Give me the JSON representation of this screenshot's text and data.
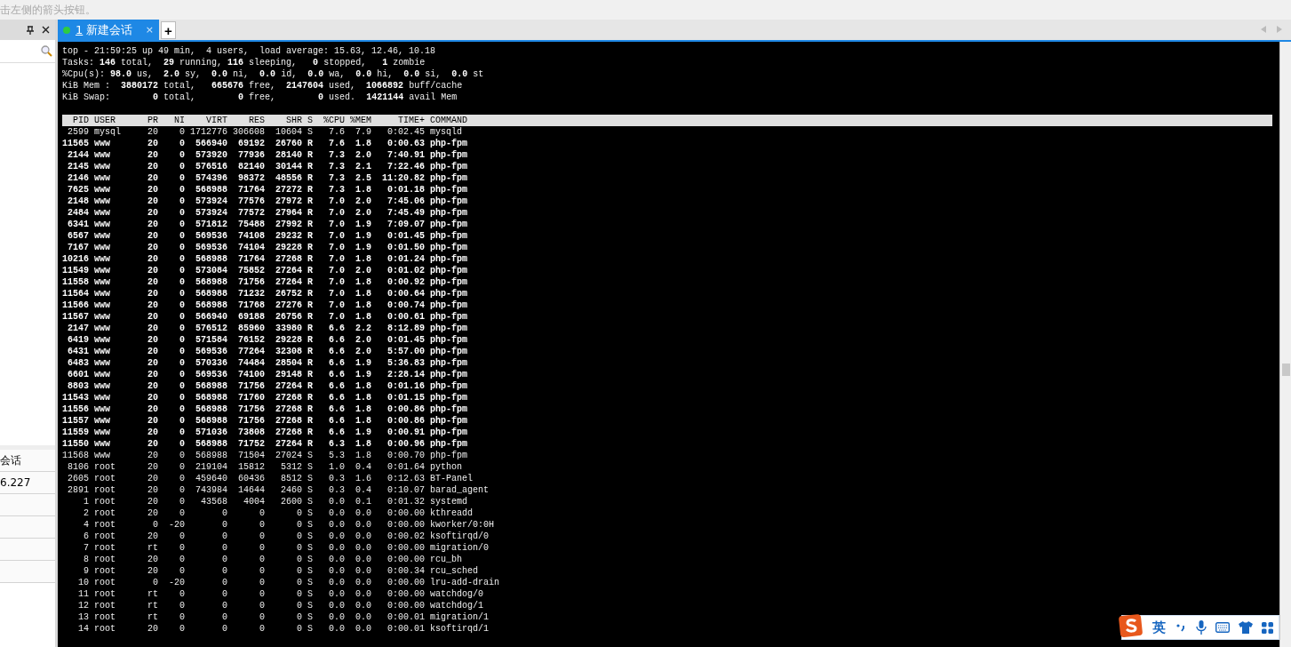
{
  "hint_bar": {
    "text": "击左侧的箭头按钮。"
  },
  "side_panel": {
    "rows": [
      "会话",
      "6.227"
    ]
  },
  "tabs": [
    {
      "number": "1",
      "label": "新建会话",
      "selected": true,
      "connected": true,
      "close": "×"
    }
  ],
  "new_tab": "+",
  "terminal": {
    "summary": [
      "top - 21:59:25 up 49 min,  4 users,  load average: 15.63, 12.46, 10.18",
      "Tasks: **146** total,  **29** running, **116** sleeping,   **0** stopped,   **1** zombie",
      "%Cpu(s): **98.0** us,  **2.0** sy,  **0.0** ni,  **0.0** id,  **0.0** wa,  **0.0** hi,  **0.0** si,  **0.0** st",
      "KiB Mem :  **3880172** total,   **665676** free,  **2147604** used,  **1066892** buff/cache",
      "KiB Swap:        **0** total,        **0** free,        **0** used.  **1421144** avail Mem"
    ],
    "columns": [
      "PID",
      "USER",
      "PR",
      "NI",
      "VIRT",
      "RES",
      "SHR",
      "S",
      "%CPU",
      "%MEM",
      "TIME+",
      "COMMAND"
    ],
    "rows": [
      {
        "bold": false,
        "cells": [
          "2599",
          "mysql",
          "20",
          "0",
          "1712776",
          "306608",
          "10604",
          "S",
          "7.6",
          "7.9",
          "0:02.45",
          "mysqld"
        ]
      },
      {
        "bold": true,
        "cells": [
          "11565",
          "www",
          "20",
          "0",
          "566940",
          "69192",
          "26760",
          "R",
          "7.6",
          "1.8",
          "0:00.63",
          "php-fpm"
        ]
      },
      {
        "bold": true,
        "cells": [
          "2144",
          "www",
          "20",
          "0",
          "573920",
          "77936",
          "28140",
          "R",
          "7.3",
          "2.0",
          "7:40.91",
          "php-fpm"
        ]
      },
      {
        "bold": true,
        "cells": [
          "2145",
          "www",
          "20",
          "0",
          "576516",
          "82140",
          "30144",
          "R",
          "7.3",
          "2.1",
          "7:22.46",
          "php-fpm"
        ]
      },
      {
        "bold": true,
        "cells": [
          "2146",
          "www",
          "20",
          "0",
          "574396",
          "98372",
          "48556",
          "R",
          "7.3",
          "2.5",
          "11:20.82",
          "php-fpm"
        ]
      },
      {
        "bold": true,
        "cells": [
          "7625",
          "www",
          "20",
          "0",
          "568988",
          "71764",
          "27272",
          "R",
          "7.3",
          "1.8",
          "0:01.18",
          "php-fpm"
        ]
      },
      {
        "bold": true,
        "cells": [
          "2148",
          "www",
          "20",
          "0",
          "573924",
          "77576",
          "27972",
          "R",
          "7.0",
          "2.0",
          "7:45.06",
          "php-fpm"
        ]
      },
      {
        "bold": true,
        "cells": [
          "2484",
          "www",
          "20",
          "0",
          "573924",
          "77572",
          "27964",
          "R",
          "7.0",
          "2.0",
          "7:45.49",
          "php-fpm"
        ]
      },
      {
        "bold": true,
        "cells": [
          "6341",
          "www",
          "20",
          "0",
          "571812",
          "75488",
          "27992",
          "R",
          "7.0",
          "1.9",
          "7:09.07",
          "php-fpm"
        ]
      },
      {
        "bold": true,
        "cells": [
          "6567",
          "www",
          "20",
          "0",
          "569536",
          "74108",
          "29232",
          "R",
          "7.0",
          "1.9",
          "0:01.45",
          "php-fpm"
        ]
      },
      {
        "bold": true,
        "cells": [
          "7167",
          "www",
          "20",
          "0",
          "569536",
          "74104",
          "29228",
          "R",
          "7.0",
          "1.9",
          "0:01.50",
          "php-fpm"
        ]
      },
      {
        "bold": true,
        "cells": [
          "10216",
          "www",
          "20",
          "0",
          "568988",
          "71764",
          "27268",
          "R",
          "7.0",
          "1.8",
          "0:01.24",
          "php-fpm"
        ]
      },
      {
        "bold": true,
        "cells": [
          "11549",
          "www",
          "20",
          "0",
          "573084",
          "75852",
          "27264",
          "R",
          "7.0",
          "2.0",
          "0:01.02",
          "php-fpm"
        ]
      },
      {
        "bold": true,
        "cells": [
          "11558",
          "www",
          "20",
          "0",
          "568988",
          "71756",
          "27264",
          "R",
          "7.0",
          "1.8",
          "0:00.92",
          "php-fpm"
        ]
      },
      {
        "bold": true,
        "cells": [
          "11564",
          "www",
          "20",
          "0",
          "568988",
          "71232",
          "26752",
          "R",
          "7.0",
          "1.8",
          "0:00.64",
          "php-fpm"
        ]
      },
      {
        "bold": true,
        "cells": [
          "11566",
          "www",
          "20",
          "0",
          "568988",
          "71768",
          "27276",
          "R",
          "7.0",
          "1.8",
          "0:00.74",
          "php-fpm"
        ]
      },
      {
        "bold": true,
        "cells": [
          "11567",
          "www",
          "20",
          "0",
          "566940",
          "69188",
          "26756",
          "R",
          "7.0",
          "1.8",
          "0:00.61",
          "php-fpm"
        ]
      },
      {
        "bold": true,
        "cells": [
          "2147",
          "www",
          "20",
          "0",
          "576512",
          "85960",
          "33980",
          "R",
          "6.6",
          "2.2",
          "8:12.89",
          "php-fpm"
        ]
      },
      {
        "bold": true,
        "cells": [
          "6419",
          "www",
          "20",
          "0",
          "571584",
          "76152",
          "29228",
          "R",
          "6.6",
          "2.0",
          "0:01.45",
          "php-fpm"
        ]
      },
      {
        "bold": true,
        "cells": [
          "6431",
          "www",
          "20",
          "0",
          "569536",
          "77264",
          "32308",
          "R",
          "6.6",
          "2.0",
          "5:57.00",
          "php-fpm"
        ]
      },
      {
        "bold": true,
        "cells": [
          "6483",
          "www",
          "20",
          "0",
          "570336",
          "74484",
          "28504",
          "R",
          "6.6",
          "1.9",
          "5:36.83",
          "php-fpm"
        ]
      },
      {
        "bold": true,
        "cells": [
          "6601",
          "www",
          "20",
          "0",
          "569536",
          "74100",
          "29148",
          "R",
          "6.6",
          "1.9",
          "2:28.14",
          "php-fpm"
        ]
      },
      {
        "bold": true,
        "cells": [
          "8803",
          "www",
          "20",
          "0",
          "568988",
          "71756",
          "27264",
          "R",
          "6.6",
          "1.8",
          "0:01.16",
          "php-fpm"
        ]
      },
      {
        "bold": true,
        "cells": [
          "11543",
          "www",
          "20",
          "0",
          "568988",
          "71760",
          "27268",
          "R",
          "6.6",
          "1.8",
          "0:01.15",
          "php-fpm"
        ]
      },
      {
        "bold": true,
        "cells": [
          "11556",
          "www",
          "20",
          "0",
          "568988",
          "71756",
          "27268",
          "R",
          "6.6",
          "1.8",
          "0:00.86",
          "php-fpm"
        ]
      },
      {
        "bold": true,
        "cells": [
          "11557",
          "www",
          "20",
          "0",
          "568988",
          "71756",
          "27268",
          "R",
          "6.6",
          "1.8",
          "0:00.86",
          "php-fpm"
        ]
      },
      {
        "bold": true,
        "cells": [
          "11559",
          "www",
          "20",
          "0",
          "571036",
          "73808",
          "27268",
          "R",
          "6.6",
          "1.9",
          "0:00.91",
          "php-fpm"
        ]
      },
      {
        "bold": true,
        "cells": [
          "11550",
          "www",
          "20",
          "0",
          "568988",
          "71752",
          "27264",
          "R",
          "6.3",
          "1.8",
          "0:00.96",
          "php-fpm"
        ]
      },
      {
        "bold": false,
        "cells": [
          "11568",
          "www",
          "20",
          "0",
          "568988",
          "71504",
          "27024",
          "S",
          "5.3",
          "1.8",
          "0:00.70",
          "php-fpm"
        ]
      },
      {
        "bold": false,
        "cells": [
          "8106",
          "root",
          "20",
          "0",
          "219104",
          "15812",
          "5312",
          "S",
          "1.0",
          "0.4",
          "0:01.64",
          "python"
        ]
      },
      {
        "bold": false,
        "cells": [
          "2605",
          "root",
          "20",
          "0",
          "459640",
          "60436",
          "8512",
          "S",
          "0.3",
          "1.6",
          "0:12.63",
          "BT-Panel"
        ]
      },
      {
        "bold": false,
        "cells": [
          "2891",
          "root",
          "20",
          "0",
          "743984",
          "14644",
          "2460",
          "S",
          "0.3",
          "0.4",
          "0:10.07",
          "barad_agent"
        ]
      },
      {
        "bold": false,
        "cells": [
          "1",
          "root",
          "20",
          "0",
          "43568",
          "4004",
          "2600",
          "S",
          "0.0",
          "0.1",
          "0:01.32",
          "systemd"
        ]
      },
      {
        "bold": false,
        "cells": [
          "2",
          "root",
          "20",
          "0",
          "0",
          "0",
          "0",
          "S",
          "0.0",
          "0.0",
          "0:00.00",
          "kthreadd"
        ]
      },
      {
        "bold": false,
        "cells": [
          "4",
          "root",
          "0",
          "-20",
          "0",
          "0",
          "0",
          "S",
          "0.0",
          "0.0",
          "0:00.00",
          "kworker/0:0H"
        ]
      },
      {
        "bold": false,
        "cells": [
          "6",
          "root",
          "20",
          "0",
          "0",
          "0",
          "0",
          "S",
          "0.0",
          "0.0",
          "0:00.02",
          "ksoftirqd/0"
        ]
      },
      {
        "bold": false,
        "cells": [
          "7",
          "root",
          "rt",
          "0",
          "0",
          "0",
          "0",
          "S",
          "0.0",
          "0.0",
          "0:00.00",
          "migration/0"
        ]
      },
      {
        "bold": false,
        "cells": [
          "8",
          "root",
          "20",
          "0",
          "0",
          "0",
          "0",
          "S",
          "0.0",
          "0.0",
          "0:00.00",
          "rcu_bh"
        ]
      },
      {
        "bold": false,
        "cells": [
          "9",
          "root",
          "20",
          "0",
          "0",
          "0",
          "0",
          "S",
          "0.0",
          "0.0",
          "0:00.34",
          "rcu_sched"
        ]
      },
      {
        "bold": false,
        "cells": [
          "10",
          "root",
          "0",
          "-20",
          "0",
          "0",
          "0",
          "S",
          "0.0",
          "0.0",
          "0:00.00",
          "lru-add-drain"
        ]
      },
      {
        "bold": false,
        "cells": [
          "11",
          "root",
          "rt",
          "0",
          "0",
          "0",
          "0",
          "S",
          "0.0",
          "0.0",
          "0:00.00",
          "watchdog/0"
        ]
      },
      {
        "bold": false,
        "cells": [
          "12",
          "root",
          "rt",
          "0",
          "0",
          "0",
          "0",
          "S",
          "0.0",
          "0.0",
          "0:00.00",
          "watchdog/1"
        ]
      },
      {
        "bold": false,
        "cells": [
          "13",
          "root",
          "rt",
          "0",
          "0",
          "0",
          "0",
          "S",
          "0.0",
          "0.0",
          "0:00.01",
          "migration/1"
        ]
      },
      {
        "bold": false,
        "cells": [
          "14",
          "root",
          "20",
          "0",
          "0",
          "0",
          "0",
          "S",
          "0.0",
          "0.0",
          "0:00.01",
          "ksoftirqd/1"
        ]
      }
    ]
  },
  "ime_toolbar": {
    "language": "英"
  }
}
